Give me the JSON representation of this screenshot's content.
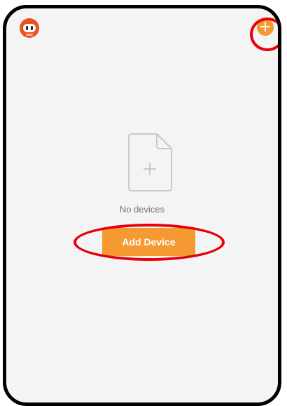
{
  "header": {
    "avatar_icon": "robot-avatar-icon",
    "add_icon": "plus-circle-icon",
    "add_symbol": "+"
  },
  "empty_state": {
    "icon": "file-plus-icon",
    "message": "No devices",
    "button_label": "Add Device"
  },
  "colors": {
    "accent": "#f59a33",
    "brand": "#e8531f",
    "annotation": "#e8000b",
    "background": "#f4f4f4"
  }
}
